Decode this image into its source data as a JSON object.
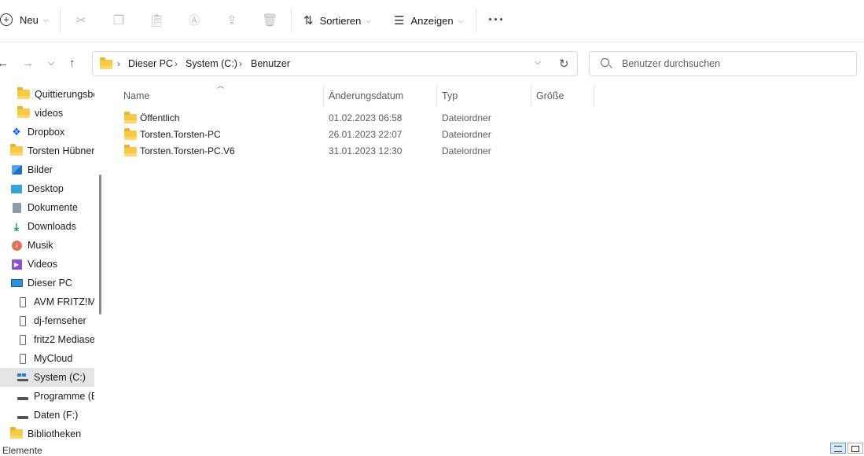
{
  "toolbar": {
    "new_label": "Neu",
    "sort_label": "Sortieren",
    "view_label": "Anzeigen",
    "more_label": "···"
  },
  "address": {
    "crumbs": [
      "Dieser PC",
      "System (C:)",
      "Benutzer"
    ]
  },
  "search": {
    "placeholder": "Benutzer durchsuchen"
  },
  "sidebar": {
    "items": [
      {
        "label": "Quittierungsbe",
        "icon": "folder-icon"
      },
      {
        "label": "videos",
        "icon": "folder-icon"
      },
      {
        "label": "Dropbox",
        "icon": "dropbox-icon"
      },
      {
        "label": "Torsten Hübner",
        "icon": "folder-icon"
      },
      {
        "label": "Bilder",
        "icon": "pictures-icon"
      },
      {
        "label": "Desktop",
        "icon": "desktop-icon"
      },
      {
        "label": "Dokumente",
        "icon": "documents-icon"
      },
      {
        "label": "Downloads",
        "icon": "download-icon"
      },
      {
        "label": "Musik",
        "icon": "music-icon"
      },
      {
        "label": "Videos",
        "icon": "videos-icon"
      },
      {
        "label": "Dieser PC",
        "icon": "monitor-icon"
      },
      {
        "label": "AVM FRITZ!Me",
        "icon": "media-server-icon"
      },
      {
        "label": "dj-fernseher",
        "icon": "media-server-icon"
      },
      {
        "label": "fritz2 Mediaser",
        "icon": "media-server-icon"
      },
      {
        "label": "MyCloud",
        "icon": "media-server-icon"
      },
      {
        "label": "System (C:)",
        "icon": "windows-drive-icon"
      },
      {
        "label": "Programme (E",
        "icon": "drive-icon"
      },
      {
        "label": "Daten (F:)",
        "icon": "drive-icon"
      },
      {
        "label": "Bibliotheken",
        "icon": "folder-icon"
      }
    ]
  },
  "columns": {
    "name": "Name",
    "date": "Änderungsdatum",
    "type": "Typ",
    "size": "Größe"
  },
  "files": [
    {
      "name": "Öffentlich",
      "date": "01.02.2023 06:58",
      "type": "Dateiordner",
      "size": ""
    },
    {
      "name": "Torsten.Torsten-PC",
      "date": "26.01.2023 22:07",
      "type": "Dateiordner",
      "size": ""
    },
    {
      "name": "Torsten.Torsten-PC.V6",
      "date": "31.01.2023 12:30",
      "type": "Dateiordner",
      "size": ""
    }
  ],
  "status": {
    "text": "Elemente"
  }
}
